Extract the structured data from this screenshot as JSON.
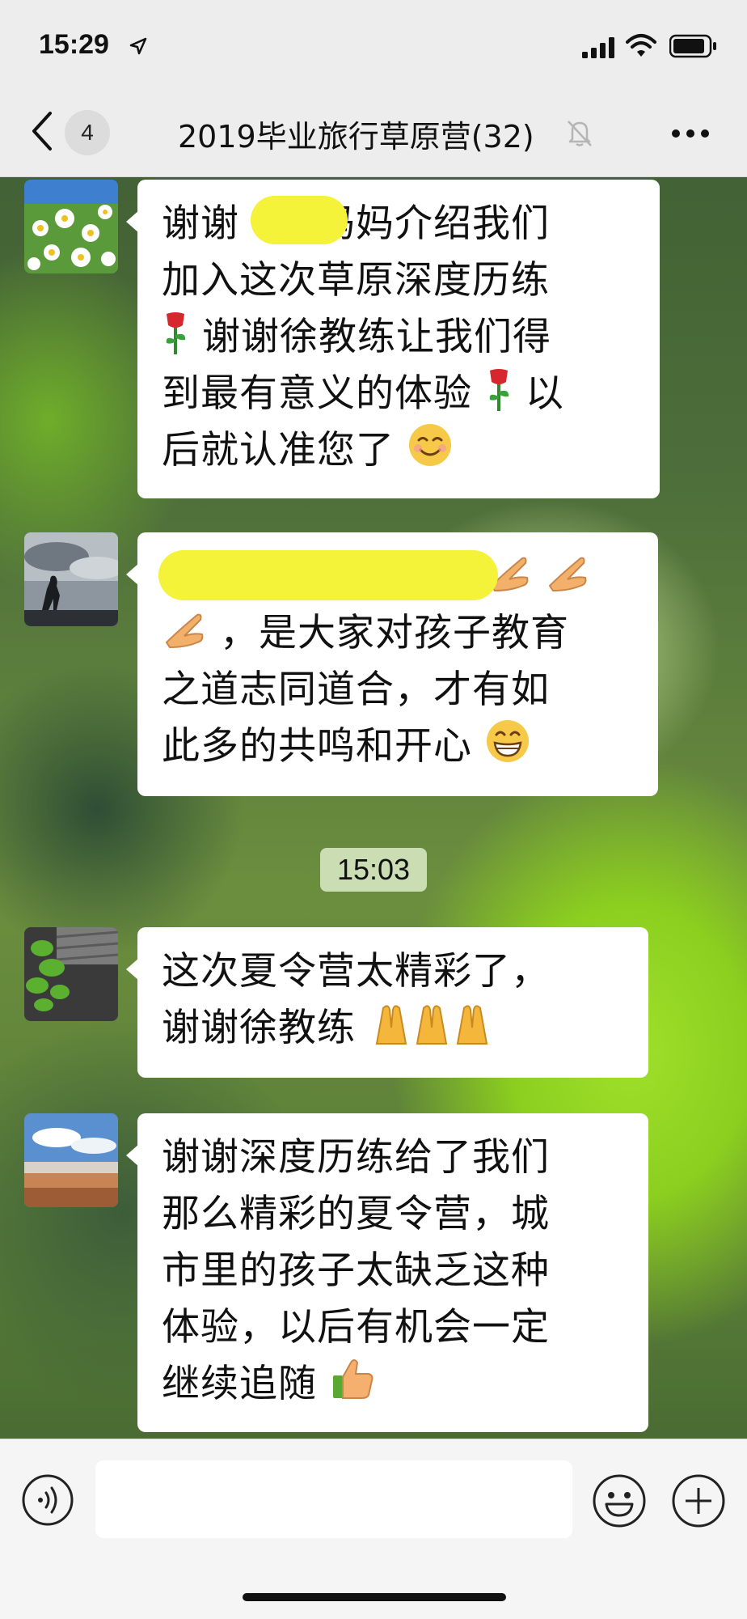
{
  "status_bar": {
    "time": "15:29"
  },
  "nav": {
    "unread_badge": "4",
    "title": "2019毕业旅行草原营(32)"
  },
  "messages": [
    {
      "lines": [
        "谢谢",
        "妈妈介绍我们",
        "加入这次草原深度历练",
        "谢谢徐教练让我们得",
        "到最有意义的体验",
        "以",
        "后就认准您了"
      ]
    },
    {
      "lines": [
        "，是大家对孩子教育",
        "之道志同道合，才有如",
        "此多的共鸣和开心"
      ]
    },
    {
      "lines": [
        "这次夏令营太精彩了，",
        "谢谢徐教练"
      ]
    },
    {
      "lines": [
        "谢谢深度历练给了我们",
        "那么精彩的夏令营，城",
        "市里的孩子太缺乏这种",
        "体验，以后有机会一定",
        "继续追随"
      ]
    }
  ],
  "timestamp": "15:03",
  "icons": {
    "back": "chevron-left-icon",
    "mute": "bell-muted-icon",
    "more": "more-dots-icon",
    "voice": "voice-icon",
    "emoji": "emoji-icon",
    "plus": "plus-icon"
  },
  "colors": {
    "bubble": "#ffffff",
    "redaction": "#f5f23a",
    "bar": "#ededed"
  }
}
